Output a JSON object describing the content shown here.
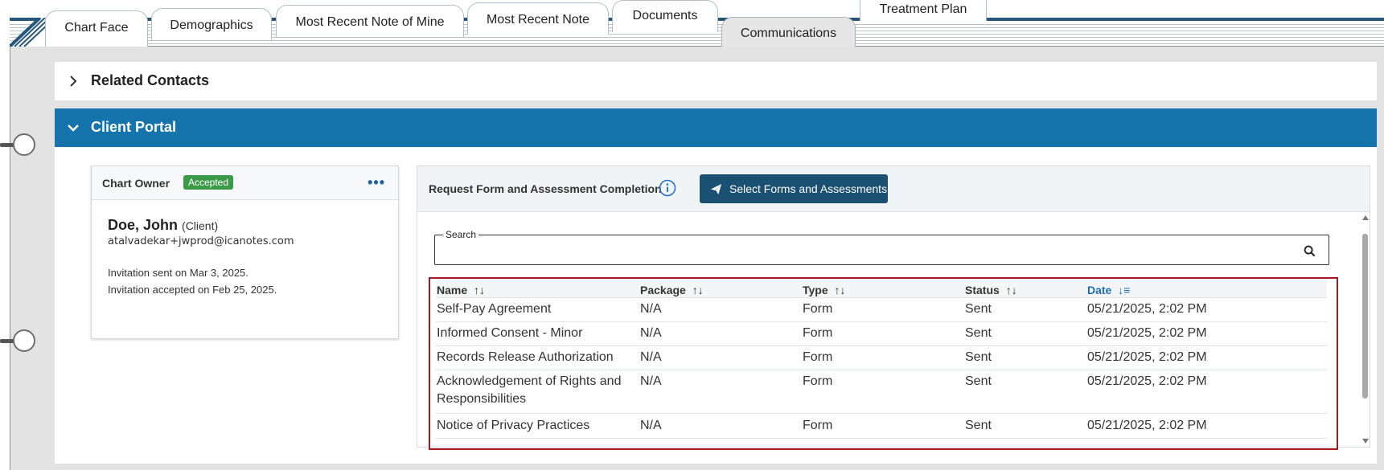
{
  "tabs": {
    "chart_face": "Chart Face",
    "demographics": "Demographics",
    "most_recent_note_mine": "Most Recent Note of Mine",
    "most_recent_note": "Most Recent Note",
    "documents": "Documents",
    "communications": "Communications",
    "treatment_plan": "Treatment Plan"
  },
  "sections": {
    "related_contacts": "Related Contacts",
    "client_portal": "Client Portal"
  },
  "owner_card": {
    "title": "Chart Owner",
    "status_badge": "Accepted",
    "more_icon": "more-horizontal-icon",
    "name": "Doe, John",
    "role": "(Client)",
    "email": "atalvadekar+jwprod@icanotes.com",
    "invite_sent": "Invitation sent on Mar 3, 2025.",
    "invite_accepted": "Invitation accepted on Feb 25, 2025."
  },
  "request_panel": {
    "title": "Request Form and Assessment Completion",
    "info_icon": "info-icon",
    "send_button": "Select Forms and Assessments",
    "search_label": "Search",
    "search_value": ""
  },
  "table": {
    "headers": {
      "name": "Name",
      "package": "Package",
      "type": "Type",
      "status": "Status",
      "date": "Date"
    },
    "sorted_column": "date",
    "rows": [
      {
        "name": "Self-Pay Agreement",
        "package": "N/A",
        "type": "Form",
        "status": "Sent",
        "date": "05/21/2025, 2:02 PM"
      },
      {
        "name": "Informed Consent - Minor",
        "package": "N/A",
        "type": "Form",
        "status": "Sent",
        "date": "05/21/2025, 2:02 PM"
      },
      {
        "name": "Records Release Authorization",
        "package": "N/A",
        "type": "Form",
        "status": "Sent",
        "date": "05/21/2025, 2:02 PM"
      },
      {
        "name": "Acknowledgement of Rights and Responsibilities",
        "package": "N/A",
        "type": "Form",
        "status": "Sent",
        "date": "05/21/2025, 2:02 PM"
      },
      {
        "name": "Notice of Privacy Practices",
        "package": "N/A",
        "type": "Form",
        "status": "Sent",
        "date": "05/21/2025, 2:02 PM"
      }
    ]
  },
  "colors": {
    "brand_blue": "#1674ad",
    "button_navy": "#1a5072",
    "accepted_green": "#3a9a47",
    "highlight_red": "#a7191f"
  }
}
